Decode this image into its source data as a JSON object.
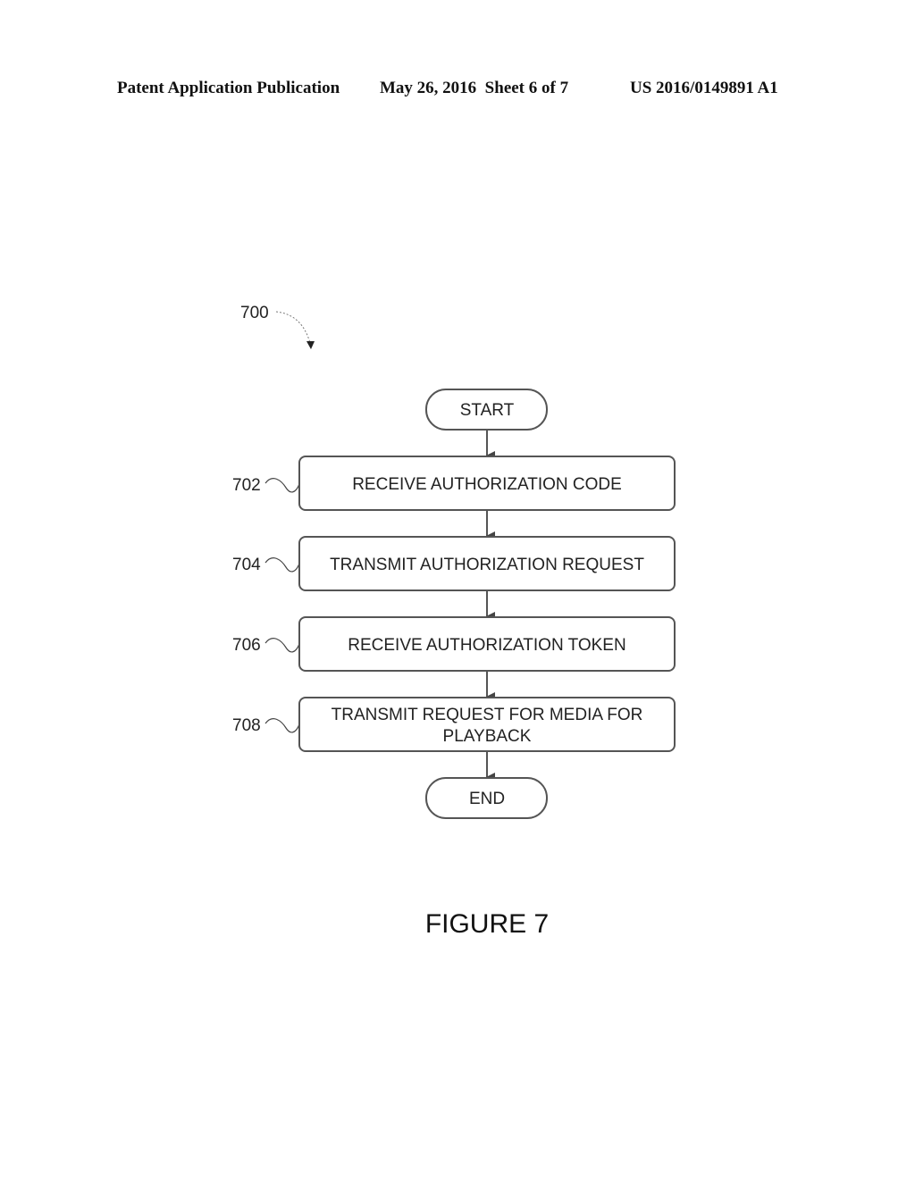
{
  "header": {
    "publication": "Patent Application Publication",
    "date_sheet": "May 26, 2016  Sheet 6 of 7",
    "number": "US 2016/0149891 A1"
  },
  "diagram": {
    "ref": "700",
    "start": "START",
    "end": "END",
    "steps": [
      {
        "ref": "702",
        "lines": [
          "RECEIVE AUTHORIZATION CODE"
        ]
      },
      {
        "ref": "704",
        "lines": [
          "TRANSMIT AUTHORIZATION REQUEST"
        ]
      },
      {
        "ref": "706",
        "lines": [
          "RECEIVE AUTHORIZATION TOKEN"
        ]
      },
      {
        "ref": "708",
        "lines": [
          "TRANSMIT REQUEST FOR MEDIA FOR",
          "PLAYBACK"
        ]
      }
    ],
    "caption": "FIGURE 7"
  }
}
